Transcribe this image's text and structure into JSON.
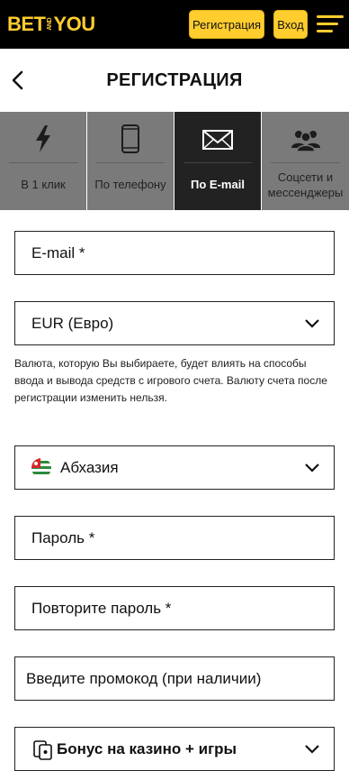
{
  "header": {
    "logo_left": "BET",
    "logo_and": "AND",
    "logo_right": "YOU",
    "register_label": "Регистрация",
    "login_label": "Вход",
    "accent_color": "#ffcd2e"
  },
  "page": {
    "title": "РЕГИСТРАЦИЯ"
  },
  "tabs": [
    {
      "label": "В 1 клик",
      "icon": "lightning-icon",
      "active": false
    },
    {
      "label": "По телефону",
      "icon": "phone-icon",
      "active": false
    },
    {
      "label": "По E-mail",
      "icon": "envelope-icon",
      "active": true
    },
    {
      "label": "Соцсети и мессенджеры",
      "icon": "people-icon",
      "active": false
    }
  ],
  "form": {
    "email_placeholder": "E-mail  *",
    "currency_value": "EUR (Евро)",
    "currency_note": "Валюта, которую Вы выбираете, будет влиять на способы ввода и вывода средств с игрового счета. Валюту счета после регистрации изменить нельзя.",
    "country_value": "Абхазия",
    "password_placeholder": "Пароль  *",
    "password_repeat_placeholder": "Повторите пароль  *",
    "promo_placeholder": "Введите промокод (при наличии)",
    "bonus_value": "Бонус на казино + игры"
  }
}
